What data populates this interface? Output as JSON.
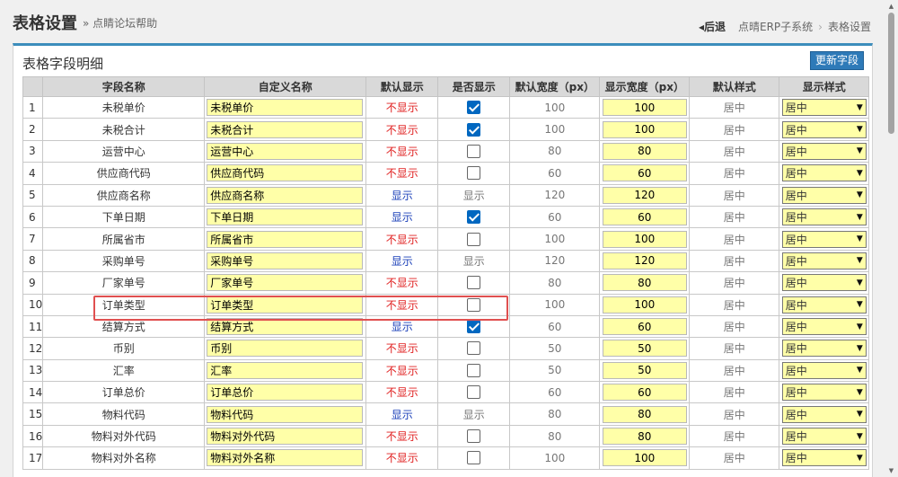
{
  "header": {
    "title": "表格设置",
    "sub_link": "» 点睛论坛帮助",
    "back": "后退",
    "breadcrumbs": [
      "点晴ERP子系统",
      "表格设置"
    ]
  },
  "panel": {
    "title": "表格字段明细",
    "update_button": "更新字段"
  },
  "columns": [
    "",
    "字段名称",
    "自定义名称",
    "默认显示",
    "是否显示",
    "默认宽度（px）",
    "显示宽度（px）",
    "默认样式",
    "显示样式"
  ],
  "style_option": "居中",
  "rows": [
    {
      "idx": "1",
      "field": "未税单价",
      "custom": "未税单价",
      "def": "不显示",
      "vis": "checked",
      "dw": "100",
      "sw": "100",
      "ds": "居中",
      "ss": "居中"
    },
    {
      "idx": "2",
      "field": "未税合计",
      "custom": "未税合计",
      "def": "不显示",
      "vis": "checked",
      "dw": "100",
      "sw": "100",
      "ds": "居中",
      "ss": "居中"
    },
    {
      "idx": "3",
      "field": "运营中心",
      "custom": "运营中心",
      "def": "不显示",
      "vis": "unchecked",
      "dw": "80",
      "sw": "80",
      "ds": "居中",
      "ss": "居中"
    },
    {
      "idx": "4",
      "field": "供应商代码",
      "custom": "供应商代码",
      "def": "不显示",
      "vis": "unchecked",
      "dw": "60",
      "sw": "60",
      "ds": "居中",
      "ss": "居中"
    },
    {
      "idx": "5",
      "field": "供应商名称",
      "custom": "供应商名称",
      "def": "显示",
      "vis": "显示",
      "dw": "120",
      "sw": "120",
      "ds": "居中",
      "ss": "居中"
    },
    {
      "idx": "6",
      "field": "下单日期",
      "custom": "下单日期",
      "def": "显示",
      "vis": "checked",
      "dw": "60",
      "sw": "60",
      "ds": "居中",
      "ss": "居中"
    },
    {
      "idx": "7",
      "field": "所属省市",
      "custom": "所属省市",
      "def": "不显示",
      "vis": "unchecked",
      "dw": "100",
      "sw": "100",
      "ds": "居中",
      "ss": "居中"
    },
    {
      "idx": "8",
      "field": "采购单号",
      "custom": "采购单号",
      "def": "显示",
      "vis": "显示",
      "dw": "120",
      "sw": "120",
      "ds": "居中",
      "ss": "居中"
    },
    {
      "idx": "9",
      "field": "厂家单号",
      "custom": "厂家单号",
      "def": "不显示",
      "vis": "unchecked",
      "dw": "80",
      "sw": "80",
      "ds": "居中",
      "ss": "居中"
    },
    {
      "idx": "10",
      "field": "订单类型",
      "custom": "订单类型",
      "def": "不显示",
      "vis": "unchecked",
      "dw": "100",
      "sw": "100",
      "ds": "居中",
      "ss": "居中"
    },
    {
      "idx": "11",
      "field": "结算方式",
      "custom": "结算方式",
      "def": "显示",
      "vis": "checked",
      "dw": "60",
      "sw": "60",
      "ds": "居中",
      "ss": "居中"
    },
    {
      "idx": "12",
      "field": "币别",
      "custom": "币别",
      "def": "不显示",
      "vis": "unchecked",
      "dw": "50",
      "sw": "50",
      "ds": "居中",
      "ss": "居中"
    },
    {
      "idx": "13",
      "field": "汇率",
      "custom": "汇率",
      "def": "不显示",
      "vis": "unchecked",
      "dw": "50",
      "sw": "50",
      "ds": "居中",
      "ss": "居中"
    },
    {
      "idx": "14",
      "field": "订单总价",
      "custom": "订单总价",
      "def": "不显示",
      "vis": "unchecked",
      "dw": "60",
      "sw": "60",
      "ds": "居中",
      "ss": "居中"
    },
    {
      "idx": "15",
      "field": "物料代码",
      "custom": "物料代码",
      "def": "显示",
      "vis": "显示",
      "dw": "80",
      "sw": "80",
      "ds": "居中",
      "ss": "居中"
    },
    {
      "idx": "16",
      "field": "物料对外代码",
      "custom": "物料对外代码",
      "def": "不显示",
      "vis": "unchecked",
      "dw": "80",
      "sw": "80",
      "ds": "居中",
      "ss": "居中"
    },
    {
      "idx": "17",
      "field": "物料对外名称",
      "custom": "物料对外名称",
      "def": "不显示",
      "vis": "unchecked",
      "dw": "100",
      "sw": "100",
      "ds": "居中",
      "ss": "居中"
    }
  ],
  "colors": {
    "accent": "#3c8dbc",
    "button": "#2e7ab8",
    "input_bg": "#ffffa8",
    "show_text": "#1a3fb8",
    "hide_text": "#e02020",
    "highlight": "#e05050"
  }
}
